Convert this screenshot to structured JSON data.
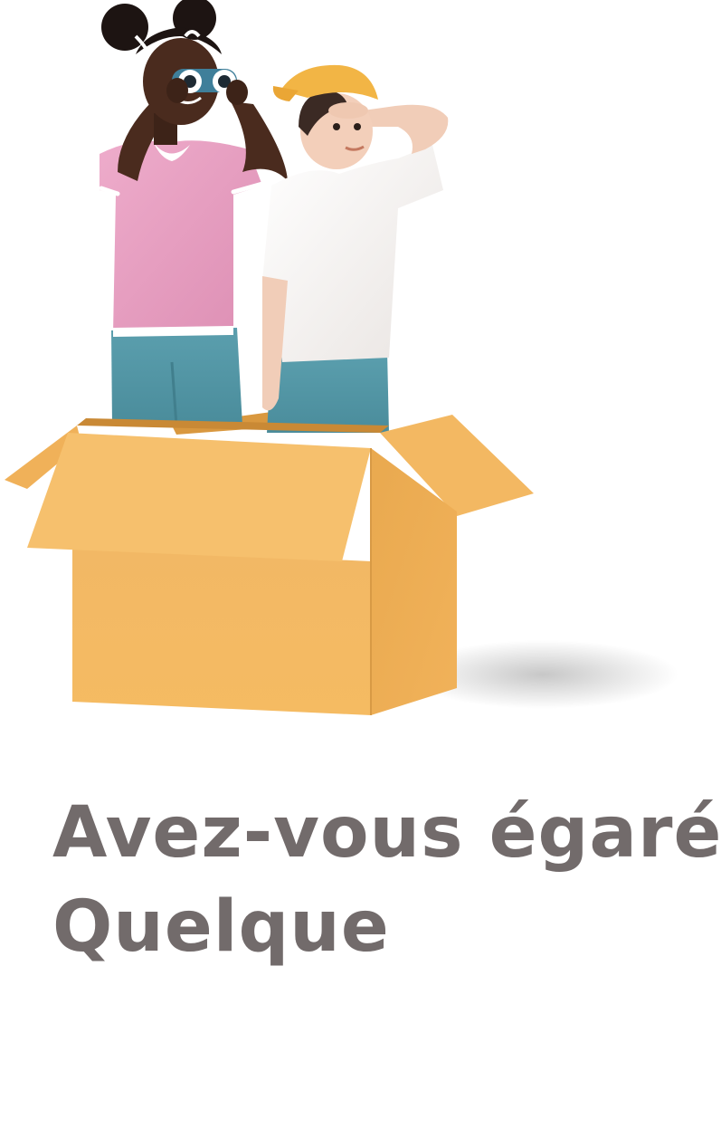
{
  "empty_state": {
    "illustration_icon": "children-in-cardboard-box-illustration",
    "headline_line1": "Avez-vous égaré",
    "headline_line2": "Quelque",
    "headline_color": "#726b6b"
  }
}
